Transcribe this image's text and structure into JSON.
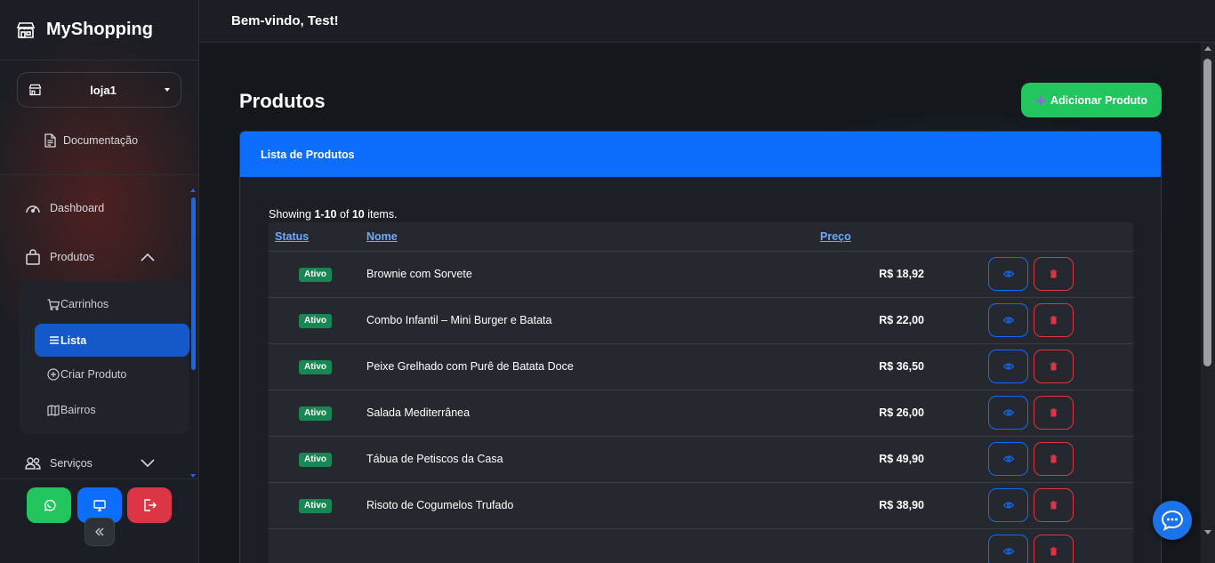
{
  "brand": {
    "name": "MyShopping",
    "icon": "store-icon"
  },
  "store_selector": {
    "value": "loja1",
    "icon": "store-icon"
  },
  "sidebar": {
    "docs_label": "Documentação",
    "nav": [
      {
        "label": "Dashboard",
        "icon": "speedometer-icon"
      },
      {
        "label": "Produtos",
        "icon": "bag-icon",
        "expanded": true
      },
      {
        "label": "Serviços",
        "icon": "people-icon",
        "expanded": false
      }
    ],
    "produtos_sub": [
      {
        "label": "Carrinhos",
        "icon": "cart-icon"
      },
      {
        "label": "Lista",
        "icon": "list-icon",
        "active": true
      },
      {
        "label": "Criar Produto",
        "icon": "plus-circle-icon"
      },
      {
        "label": "Bairros",
        "icon": "map-icon"
      }
    ],
    "bottom_buttons": [
      {
        "name": "whatsapp",
        "icon": "whatsapp-icon",
        "color": "#22c55e"
      },
      {
        "name": "display",
        "icon": "monitor-icon",
        "color": "#0d6efd"
      },
      {
        "name": "logout",
        "icon": "logout-icon",
        "color": "#dc3545"
      }
    ]
  },
  "header": {
    "welcome": "Bem-vindo, Test!"
  },
  "page": {
    "title": "Produtos",
    "add_button": "Adicionar Produto",
    "card_title": "Lista de Produtos",
    "summary": {
      "prefix": "Showing ",
      "range": "1-10",
      "mid": " of ",
      "total": "10",
      "suffix": " items."
    },
    "columns": {
      "status": "Status",
      "name": "Nome",
      "price": "Preço"
    },
    "rows": [
      {
        "status": "Ativo",
        "name": "Brownie com Sorvete",
        "price": "R$ 18,92"
      },
      {
        "status": "Ativo",
        "name": "Combo Infantil – Mini Burger e Batata",
        "price": "R$ 22,00"
      },
      {
        "status": "Ativo",
        "name": "Peixe Grelhado com Purê de Batata Doce",
        "price": "R$ 36,50"
      },
      {
        "status": "Ativo",
        "name": "Salada Mediterrânea",
        "price": "R$ 26,00"
      },
      {
        "status": "Ativo",
        "name": "Tábua de Petiscos da Casa",
        "price": "R$ 49,90"
      },
      {
        "status": "Ativo",
        "name": "Risoto de Cogumelos Trufado",
        "price": "R$ 38,90"
      }
    ]
  },
  "colors": {
    "primary": "#0d6efd",
    "success": "#22c55e",
    "danger": "#dc3545",
    "badge": "#198754",
    "link": "#6ea8fe"
  }
}
